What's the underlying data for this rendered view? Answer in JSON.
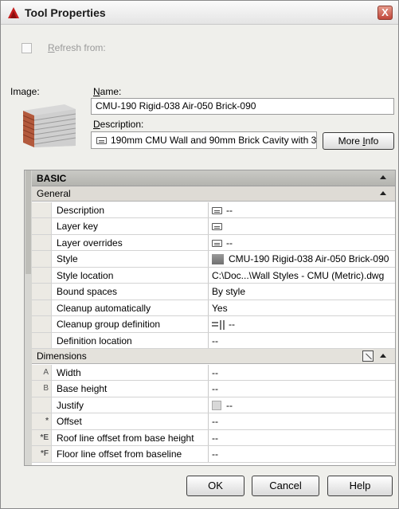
{
  "window": {
    "title": "Tool Properties",
    "close_glyph": "X"
  },
  "refresh": {
    "label_first": "R",
    "label_rest": "efresh from:",
    "checked": false
  },
  "image": {
    "label": "Image:"
  },
  "name": {
    "label_first": "N",
    "label_rest": "ame:",
    "value": "CMU-190 Rigid-038 Air-050 Brick-090"
  },
  "description": {
    "label_first": "D",
    "label_rest": "escription:",
    "value": "190mm CMU Wall and 90mm Brick Cavity with 3"
  },
  "more_info": {
    "label_main": "More ",
    "label_u": "I",
    "label_rest": "nfo"
  },
  "grid": {
    "category": "BASIC",
    "general": {
      "label": "General",
      "rows": [
        {
          "name": "Description",
          "value": "--",
          "icon": "text-icon"
        },
        {
          "name": "Layer key",
          "value": "",
          "icon": "text-icon"
        },
        {
          "name": "Layer overrides",
          "value": "--",
          "icon": "text-icon"
        },
        {
          "name": "Style",
          "value": "CMU-190 Rigid-038 Air-050 Brick-090",
          "icon": "style-swatch-icon"
        },
        {
          "name": "Style location",
          "value": "C:\\Doc...\\Wall Styles - CMU (Metric).dwg"
        },
        {
          "name": "Bound spaces",
          "value": "By style"
        },
        {
          "name": "Cleanup automatically",
          "value": "Yes"
        },
        {
          "name": "Cleanup group definition",
          "value": "--",
          "icon": "cleanup-group-icon"
        },
        {
          "name": "Definition location",
          "value": "--"
        }
      ]
    },
    "dimensions": {
      "label": "Dimensions",
      "rows": [
        {
          "mark": "A",
          "name": "Width",
          "value": "--"
        },
        {
          "mark": "B",
          "name": "Base height",
          "value": "--"
        },
        {
          "mark": "",
          "name": "Justify",
          "value": "--",
          "icon": "justify-icon"
        },
        {
          "mark": "*",
          "name": "Offset",
          "value": "--"
        },
        {
          "mark": "*E",
          "name": "Roof line offset from base height",
          "value": "--"
        },
        {
          "mark": "*F",
          "name": "Floor line offset from baseline",
          "value": "--"
        }
      ]
    }
  },
  "buttons": {
    "ok": "OK",
    "cancel": "Cancel",
    "help": "Help"
  },
  "colors": {
    "accent_red": "#c0463a",
    "grid_header": "#b4b4af",
    "subcategory": "#dedbd5"
  }
}
